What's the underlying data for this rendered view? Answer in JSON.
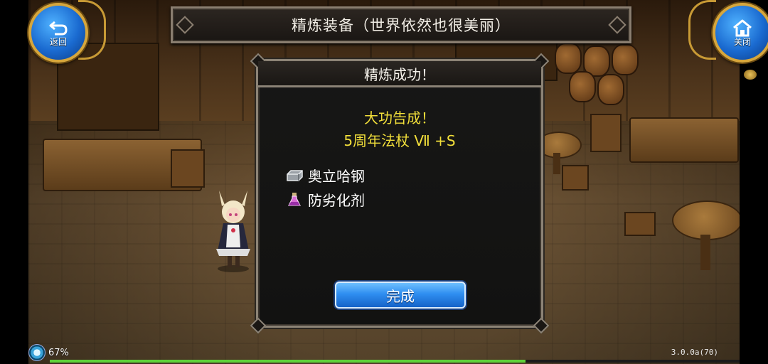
{
  "header": {
    "title": "精炼装备（世界依然也很美丽）"
  },
  "corner_buttons": {
    "back_label": "返回",
    "close_label": "关闭"
  },
  "dialog": {
    "title": "精炼成功！",
    "result_line1": "大功告成！",
    "result_line2": "5周年法杖 Ⅶ +S",
    "materials": [
      {
        "icon": "ingot-icon",
        "label": "奥立哈钢"
      },
      {
        "icon": "potion-icon",
        "label": "防劣化剂"
      }
    ],
    "confirm_label": "完成"
  },
  "status_bar": {
    "battery": "67%",
    "version": "3.0.0a(70)",
    "progress": 0.69
  },
  "colors": {
    "title_yellow": "#f2df3a",
    "button_blue": "#2f8ef0",
    "frame": "#8c8376"
  }
}
